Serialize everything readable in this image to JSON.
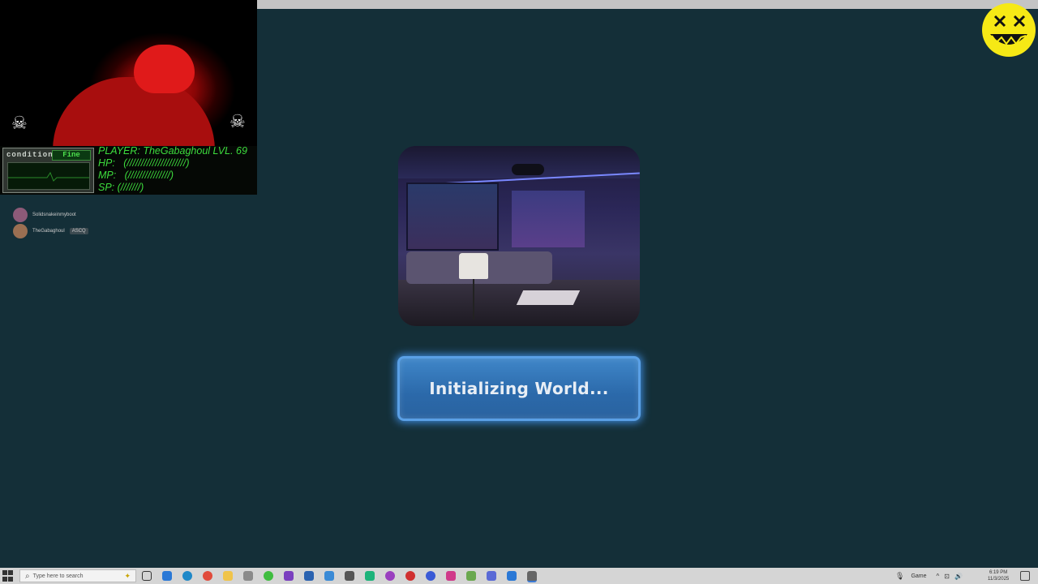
{
  "overlay": {
    "condition_label": "condition",
    "condition_value": "Fine",
    "stats": {
      "player": "PLAYER: TheGabaghoul LVL. 69",
      "hp": "HP:   (/////////////////////)",
      "mp": "MP:   (///////////////)",
      "sp": "SP: (///////)"
    }
  },
  "chat": [
    {
      "name": "Solidsnakeinmyboot",
      "badge": ""
    },
    {
      "name": "TheGabaghoul",
      "badge": "ASCQ"
    }
  ],
  "loading": {
    "status_text": "Initializing World..."
  },
  "taskbar": {
    "search_placeholder": "Type here to search",
    "tray_label": "Game",
    "time": "6:19 PM",
    "date": "11/3/2025"
  },
  "colors": {
    "background": "#142f38",
    "status_button": "#2f6fb0",
    "hud_green": "#3ddc3d",
    "logo_yellow": "#f6e915"
  }
}
